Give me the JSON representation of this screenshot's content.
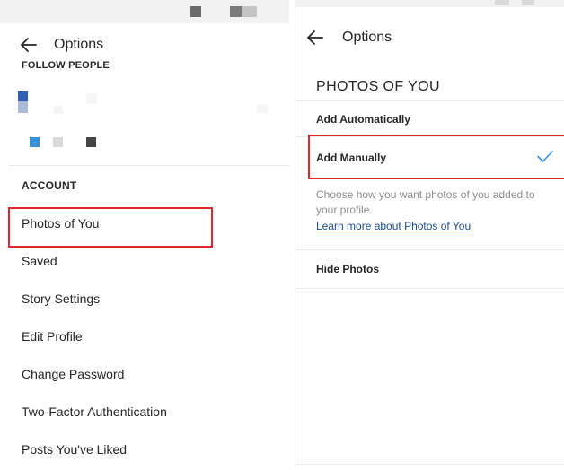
{
  "left": {
    "title": "Options",
    "follow_people_label": "FOLLOW PEOPLE",
    "account_label": "ACCOUNT",
    "menu": [
      "Photos of You",
      "Saved",
      "Story Settings",
      "Edit Profile",
      "Change Password",
      "Two-Factor Authentication",
      "Posts You've Liked"
    ]
  },
  "right": {
    "title": "Options",
    "section_title": "PHOTOS OF YOU",
    "options": {
      "add_automatically": "Add Automatically",
      "add_manually": "Add Manually",
      "hide_photos": "Hide Photos"
    },
    "selected_option": "Add Manually",
    "description": "Choose how you want photos of you added to your profile.",
    "learn_more": "Learn more about Photos of You"
  },
  "colors": {
    "highlight": "#e0272d",
    "check": "#3897f0",
    "link": "#1f4e8a"
  }
}
